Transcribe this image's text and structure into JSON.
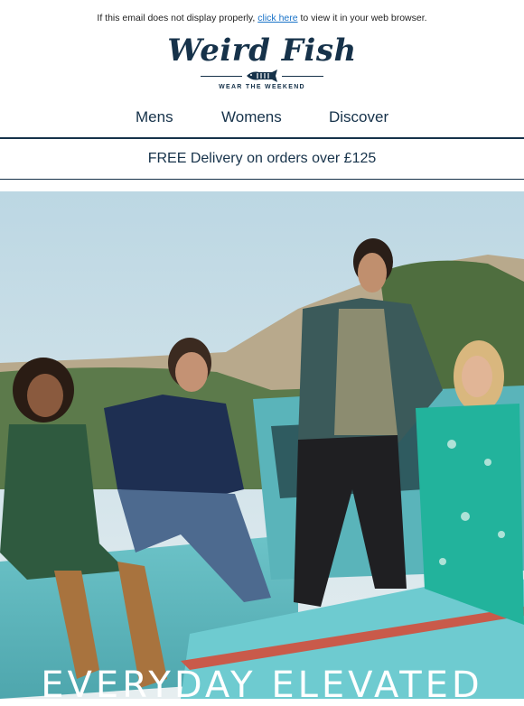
{
  "header": {
    "notice_prefix": "If this email does not display properly, ",
    "notice_link": "click here",
    "notice_suffix": " to view it in your web browser.",
    "brand": "Weird Fish",
    "tagline": "WEAR THE WEEKEND",
    "fish_icon": "fish-skeleton-icon"
  },
  "nav": {
    "items": [
      {
        "label": "Mens"
      },
      {
        "label": "Womens"
      },
      {
        "label": "Discover"
      }
    ]
  },
  "banner": {
    "delivery_text": "FREE Delivery on orders over £125"
  },
  "hero": {
    "headline": "EVERYDAY ELEVATED",
    "colors": {
      "sky": "#c9dde6",
      "truck": "#5fb8bf",
      "navy": "#16324a"
    }
  }
}
